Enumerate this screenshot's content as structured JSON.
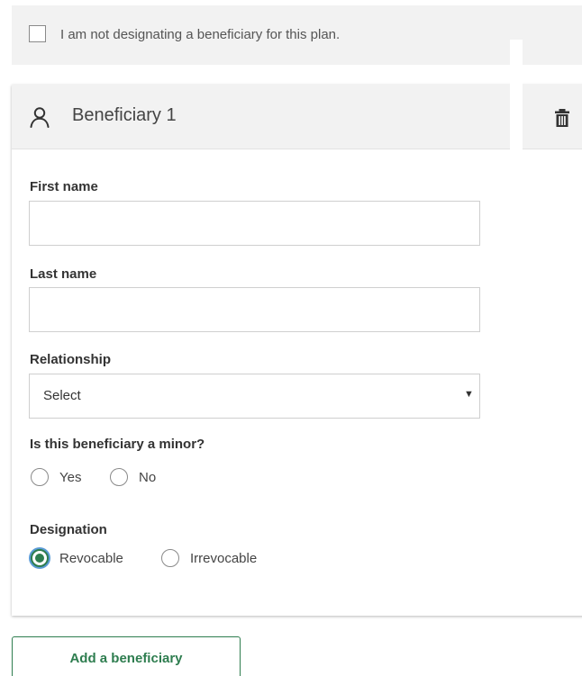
{
  "optout": {
    "label": "I am not designating a beneficiary for this plan.",
    "checked": false
  },
  "beneficiary": {
    "title": "Beneficiary 1",
    "icon": "person-icon",
    "delete_icon": "trash-icon",
    "first_name": {
      "label": "First name",
      "value": "",
      "placeholder": ""
    },
    "last_name": {
      "label": "Last name",
      "value": "",
      "placeholder": ""
    },
    "relationship": {
      "label": "Relationship",
      "selected": "Select"
    },
    "minor": {
      "question": "Is this beneficiary a minor?",
      "options": [
        "Yes",
        "No"
      ],
      "selected": null
    },
    "designation": {
      "label": "Designation",
      "options": [
        "Revocable",
        "Irrevocable"
      ],
      "selected": "Revocable"
    }
  },
  "actions": {
    "add_label": "Add a beneficiary"
  },
  "colors": {
    "accent_green": "#2e7d4f",
    "header_bg": "#f2f2f2",
    "focus_ring": "#5a9bd6"
  }
}
